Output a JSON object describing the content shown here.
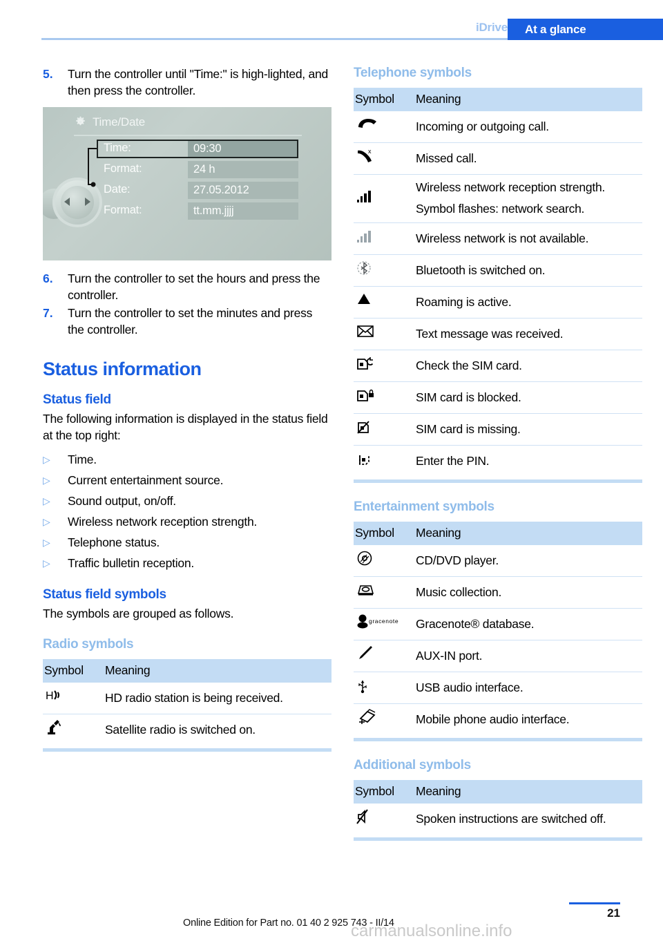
{
  "header": {
    "chapter": "iDrive",
    "tab": "At a glance"
  },
  "left_column": {
    "steps": [
      {
        "num": "5.",
        "text": "Turn the controller until \"Time:\" is high-lighted, and then press the controller."
      },
      {
        "num": "6.",
        "text": "Turn the controller to set the hours and press the controller."
      },
      {
        "num": "7.",
        "text": "Turn the controller to set the minutes and press the controller."
      }
    ],
    "illustration": {
      "title": "Time/Date",
      "rows": [
        {
          "label": "Time:",
          "value": "09:30",
          "selected": true
        },
        {
          "label": "Format:",
          "value": "24 h",
          "selected": false
        },
        {
          "label": "Date:",
          "value": "27.05.2012",
          "selected": false
        },
        {
          "label": "Format:",
          "value": "tt.mm.jjjj",
          "selected": false
        }
      ]
    },
    "status_heading": "Status information",
    "status_field_heading": "Status field",
    "status_field_intro": "The following information is displayed in the status field at the top right:",
    "status_items": [
      "Time.",
      "Current entertainment source.",
      "Sound output, on/off.",
      "Wireless network reception strength.",
      "Telephone status.",
      "Traffic bulletin reception."
    ],
    "status_symbols_heading": "Status field symbols",
    "status_symbols_intro": "The symbols are grouped as follows.",
    "radio_table": {
      "caption": "Radio symbols",
      "columns": [
        "Symbol",
        "Meaning"
      ],
      "rows": [
        {
          "icon": "hd-radio-icon",
          "meaning": "HD radio station is being received."
        },
        {
          "icon": "satellite-radio-icon",
          "meaning": "Satellite radio is switched on."
        }
      ]
    }
  },
  "right_column": {
    "telephone_table": {
      "caption": "Telephone symbols",
      "columns": [
        "Symbol",
        "Meaning"
      ],
      "rows": [
        {
          "icon": "phone-handset-icon",
          "meaning": "Incoming or outgoing call.",
          "note": ""
        },
        {
          "icon": "missed-call-icon",
          "meaning": "Missed call.",
          "note": ""
        },
        {
          "icon": "signal-bars-icon",
          "meaning": "Wireless network reception strength.",
          "note": "Symbol flashes: network search."
        },
        {
          "icon": "signal-bars-gray-icon",
          "meaning": "Wireless network is not available.",
          "note": ""
        },
        {
          "icon": "bluetooth-icon",
          "meaning": "Bluetooth is switched on.",
          "note": ""
        },
        {
          "icon": "roaming-triangle-icon",
          "meaning": "Roaming is active.",
          "note": ""
        },
        {
          "icon": "envelope-icon",
          "meaning": "Text message was received.",
          "note": ""
        },
        {
          "icon": "sim-check-icon",
          "meaning": "Check the SIM card.",
          "note": ""
        },
        {
          "icon": "sim-blocked-icon",
          "meaning": "SIM card is blocked.",
          "note": ""
        },
        {
          "icon": "sim-missing-icon",
          "meaning": "SIM card is missing.",
          "note": ""
        },
        {
          "icon": "sim-pin-icon",
          "meaning": "Enter the PIN.",
          "note": ""
        }
      ]
    },
    "entertainment_table": {
      "caption": "Entertainment symbols",
      "columns": [
        "Symbol",
        "Meaning"
      ],
      "rows": [
        {
          "icon": "cd-dvd-icon",
          "meaning": "CD/DVD player."
        },
        {
          "icon": "music-collection-icon",
          "meaning": "Music collection."
        },
        {
          "icon": "gracenote-icon",
          "meaning": "Gracenote® database."
        },
        {
          "icon": "aux-in-icon",
          "meaning": "AUX-IN port."
        },
        {
          "icon": "usb-icon",
          "meaning": "USB audio interface."
        },
        {
          "icon": "mobile-audio-icon",
          "meaning": "Mobile phone audio interface."
        }
      ]
    },
    "additional_table": {
      "caption": "Additional symbols",
      "columns": [
        "Symbol",
        "Meaning"
      ],
      "rows": [
        {
          "icon": "speaker-muted-icon",
          "meaning": "Spoken instructions are switched off."
        }
      ]
    }
  },
  "footer": {
    "edition": "Online Edition for Part no. 01 40 2 925 743 - II/14",
    "page": "21",
    "watermark": "carmanualsonline.info"
  },
  "colors": {
    "accent_blue": "#1a5fe0",
    "light_blue": "#8fbcea",
    "table_header_bg": "#c3dcf4",
    "rule_blue": "#cfe1f4"
  }
}
